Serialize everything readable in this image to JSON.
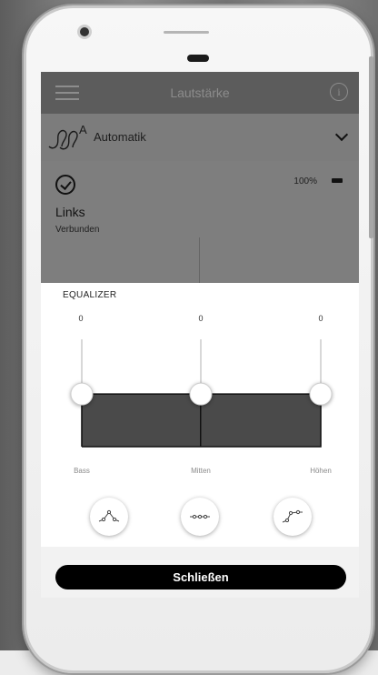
{
  "header": {
    "title": "Lautstärke",
    "menu_icon": "menu-icon",
    "info_icon": "info-icon",
    "info_glyph": "i"
  },
  "program": {
    "icon": "hearing-aid-automatic-icon",
    "badge": "A",
    "label": "Automatik"
  },
  "device": {
    "side": "Links",
    "status": "Verbunden",
    "battery": "100%",
    "battery_level": 1.0
  },
  "equalizer": {
    "title": "EQUALIZER",
    "bands": [
      {
        "label": "Bass",
        "gain": "0",
        "level": 0.5
      },
      {
        "label": "Mitten",
        "gain": "0",
        "level": 0.5
      },
      {
        "label": "Höhen",
        "gain": "0",
        "level": 0.5
      }
    ],
    "presets": [
      "preset-peak-icon",
      "preset-flat-icon",
      "preset-rising-icon"
    ]
  },
  "footer": {
    "close_label": "Schließen"
  },
  "colors": {
    "topbar": "#5c5c5c",
    "status_panel": "#7e7e7e",
    "eq_fill": "#4a4a4a",
    "button": "#000000"
  }
}
